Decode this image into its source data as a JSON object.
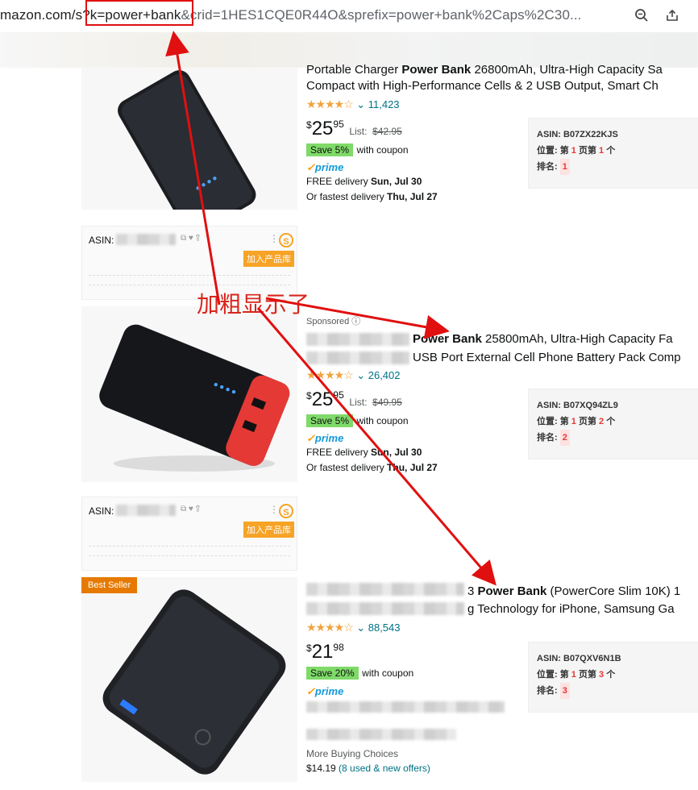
{
  "browser": {
    "url_prefix": "mazon.com/s",
    "url_query": "?k=power+bank",
    "url_rest": "&crid=1HES1CQE0R44O&sprefix=power+bank%2Caps%2C30...",
    "icons": [
      "zoom-icon",
      "share-icon"
    ]
  },
  "annotation": {
    "text": "加粗显示了",
    "color": "#d9261c"
  },
  "products": [
    {
      "title_pre": "Portable Charger ",
      "title_bold": "Power Bank",
      "title_post": " 26800mAh, Ultra-High Capacity Sa",
      "title_line2": "Compact with High-Performance Cells & 2 USB Output, Smart Ch",
      "rating_count": "11,423",
      "price_dollars": "25",
      "price_cents": "95",
      "list_label": "List:",
      "list_price": "$42.95",
      "coupon": "Save 5%",
      "coupon_text": "with coupon",
      "prime": "prime",
      "delivery1_pre": "FREE delivery ",
      "delivery1_date": "Sun, Jul 30",
      "delivery2_pre": "Or fastest delivery ",
      "delivery2_date": "Thu, Jul 27",
      "asin": "ASIN: B07ZX22KJS",
      "pos_pre": "位置: 第",
      "pos_page": "1",
      "pos_mid": "页第",
      "pos_idx": "1",
      "pos_post": "个",
      "rank_label": "排名:",
      "rank": "1"
    },
    {
      "sponsored": "Sponsored",
      "title_bold": "Power Bank",
      "title_post": " 25800mAh, Ultra-High Capacity Fa",
      "title_line2": "USB Port External Cell Phone Battery Pack Comp",
      "rating_count": "26,402",
      "price_dollars": "25",
      "price_cents": "95",
      "list_label": "List:",
      "list_price": "$49.95",
      "coupon": "Save 5%",
      "coupon_text": "with coupon",
      "prime": "prime",
      "delivery1_pre": "FREE delivery ",
      "delivery1_date": "Sun, Jul 30",
      "delivery2_pre": "Or fastest delivery ",
      "delivery2_date": "Thu, Jul 27",
      "asin": "ASIN: B07XQ94ZL9",
      "pos_pre": "位置: 第",
      "pos_page": "1",
      "pos_mid": "页第",
      "pos_idx": "2",
      "pos_post": "个",
      "rank_label": "排名:",
      "rank": "2"
    },
    {
      "badge": "Best Seller",
      "title_bold": "Power Bank",
      "title_pre": "3 ",
      "title_post": " (PowerCore Slim 10K) 1",
      "title_line2": "g Technology for iPhone, Samsung Ga",
      "rating_count": "88,543",
      "price_dollars": "21",
      "price_cents": "98",
      "coupon": "Save 20%",
      "coupon_text": "with coupon",
      "prime": "prime",
      "more_buying": "More Buying Choices",
      "more_price": "$14.19",
      "more_offers": "(8 used & new offers)",
      "asin": "ASIN: B07QXV6N1B",
      "pos_pre": "位置: 第",
      "pos_page": "1",
      "pos_mid": "页第",
      "pos_idx": "3",
      "pos_post": "个",
      "rank_label": "排名:",
      "rank": "3"
    }
  ],
  "seller_panels": [
    {
      "asin_label": "ASIN:",
      "add_button": "加入产品库",
      "logo": "S"
    },
    {
      "asin_label": "ASIN:",
      "add_button": "加入产品库",
      "logo": "S"
    }
  ]
}
